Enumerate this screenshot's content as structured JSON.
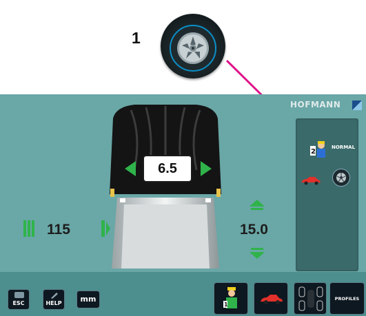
{
  "callout": {
    "number": "1"
  },
  "brand": {
    "name": "HOFMANN"
  },
  "panel": {
    "mode": "NORMAL"
  },
  "measurements": {
    "width": "6.5",
    "offset": "115",
    "diameter": "15.0"
  },
  "buttons": {
    "esc": "ESC",
    "help": "HELP",
    "unit": "mm",
    "profiles": "PROFILES"
  },
  "colors": {
    "screen_bg": "#6aa7a7",
    "arrow_green": "#2fb34a",
    "callout_line": "#e0158a"
  }
}
